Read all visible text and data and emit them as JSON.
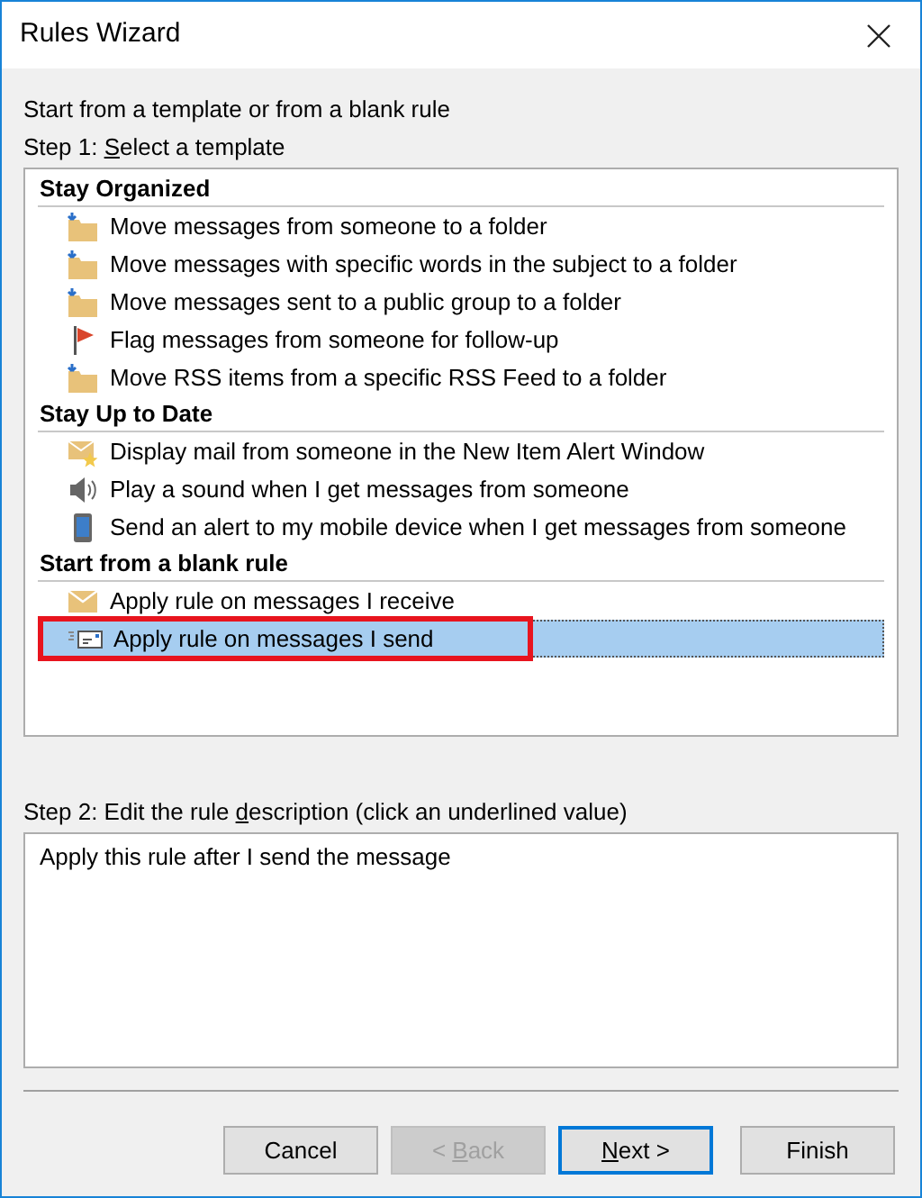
{
  "window": {
    "title": "Rules Wizard"
  },
  "intro": "Start from a template or from a blank rule",
  "step1_label": {
    "before": "Step 1: ",
    "key": "S",
    "after": "elect a template"
  },
  "groups": [
    {
      "title": "Stay Organized",
      "items": [
        {
          "label": "Move messages from someone to a folder",
          "kind": "move",
          "selected": false,
          "highlighted": false
        },
        {
          "label": "Move messages with specific words in the subject to a folder",
          "kind": "move",
          "selected": false,
          "highlighted": false
        },
        {
          "label": "Move messages sent to a public group to a folder",
          "kind": "move",
          "selected": false,
          "highlighted": false
        },
        {
          "label": "Flag messages from someone for follow-up",
          "kind": "flag",
          "selected": false,
          "highlighted": false
        },
        {
          "label": "Move RSS items from a specific RSS Feed to a folder",
          "kind": "move",
          "selected": false,
          "highlighted": false
        }
      ]
    },
    {
      "title": "Stay Up to Date",
      "items": [
        {
          "label": "Display mail from someone in the New Item Alert Window",
          "kind": "alert",
          "selected": false,
          "highlighted": false
        },
        {
          "label": "Play a sound when I get messages from someone",
          "kind": "sound",
          "selected": false,
          "highlighted": false
        },
        {
          "label": "Send an alert to my mobile device when I get messages from someone",
          "kind": "mobile",
          "selected": false,
          "highlighted": false
        }
      ]
    },
    {
      "title": "Start from a blank rule",
      "items": [
        {
          "label": "Apply rule on messages I receive",
          "kind": "receive",
          "selected": false,
          "highlighted": false
        },
        {
          "label": "Apply rule on messages I send",
          "kind": "send",
          "selected": true,
          "highlighted": true
        }
      ]
    }
  ],
  "step2_label": {
    "before": "Step 2: Edit the rule ",
    "key": "d",
    "after": "escription (click an underlined value)"
  },
  "description": "Apply this rule after I send the message",
  "buttons": [
    {
      "after": "Cancel",
      "disabled": false,
      "default": false
    },
    {
      "before": "< ",
      "key": "B",
      "after": "ack",
      "disabled": true,
      "default": false
    },
    {
      "key": "N",
      "after": "ext >",
      "disabled": false,
      "default": true
    },
    {
      "after": "Finish",
      "disabled": false,
      "default": false
    }
  ]
}
